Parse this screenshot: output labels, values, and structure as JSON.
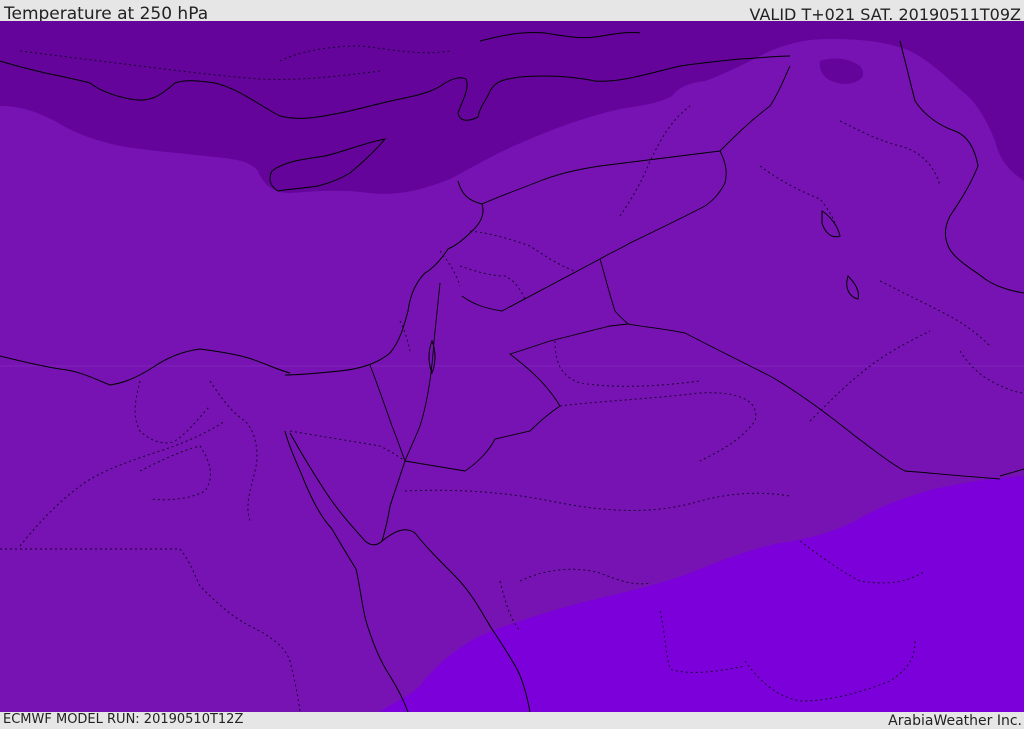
{
  "header": {
    "title": "Temperature at 250 hPa",
    "valid": "VALID T+021 SAT. 20190511T09Z"
  },
  "footer": {
    "model_run": "ECMWF MODEL RUN: 20190510T12Z",
    "credit": "ArabiaWeather Inc."
  },
  "map": {
    "parameter": "temperature",
    "level": "250 hPa",
    "colors": {
      "coldest_band": "#64049a",
      "mid_band": "#7713b3",
      "warmest_band": "#7c00d9",
      "coastline": "#000000",
      "border_line": "#000000",
      "internal_boundary": "#1a0030"
    }
  }
}
